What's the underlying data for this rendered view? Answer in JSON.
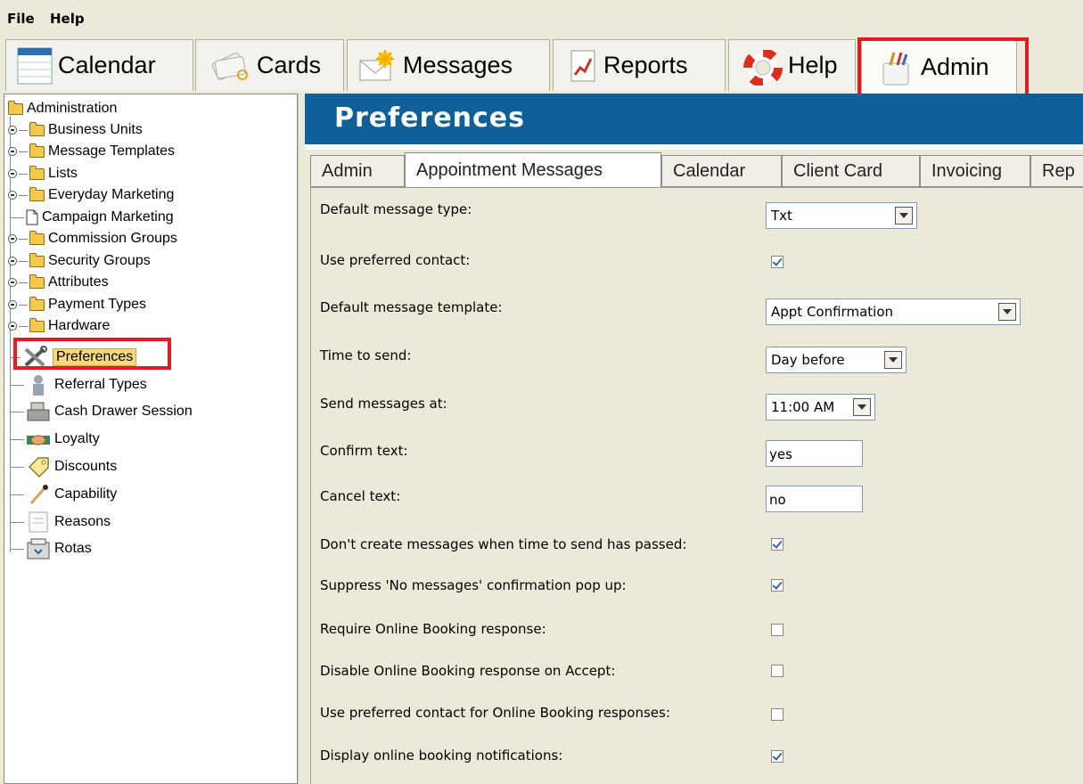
{
  "menu": {
    "file": "File",
    "help": "Help"
  },
  "toolbar": {
    "calendar": "Calendar",
    "cards": "Cards",
    "messages": "Messages",
    "reports": "Reports",
    "help": "Help",
    "admin": "Admin"
  },
  "tree": {
    "root": "Administration",
    "items": [
      "Business Units",
      "Message Templates",
      "Lists",
      "Everyday Marketing",
      "Campaign Marketing",
      "Commission Groups",
      "Security Groups",
      "Attributes",
      "Payment Types",
      "Hardware",
      "Preferences",
      "Referral Types",
      "Cash Drawer Session",
      "Loyalty",
      "Discounts",
      "Capability",
      "Reasons",
      "Rotas"
    ]
  },
  "banner": {
    "title": "Preferences"
  },
  "subtabs": [
    "Admin",
    "Appointment Messages",
    "Calendar",
    "Client Card",
    "Invoicing",
    "Rep"
  ],
  "form": {
    "default_message_type": {
      "label": "Default message type:",
      "value": "Txt"
    },
    "use_preferred_contact": {
      "label": "Use preferred contact:",
      "checked": true
    },
    "default_message_template": {
      "label": "Default message template:",
      "value": "Appt Confirmation"
    },
    "time_to_send": {
      "label": "Time to send:",
      "value": "Day before"
    },
    "send_messages_at": {
      "label": "Send messages at:",
      "value": "11:00 AM"
    },
    "confirm_text": {
      "label": "Confirm text:",
      "value": "yes"
    },
    "cancel_text": {
      "label": "Cancel text:",
      "value": "no"
    },
    "dont_create_passed": {
      "label": "Don't create messages when time to send has passed:",
      "checked": true
    },
    "suppress_no_messages": {
      "label": "Suppress 'No messages' confirmation pop up:",
      "checked": true
    },
    "require_online_booking": {
      "label": "Require Online Booking response:",
      "checked": false
    },
    "disable_online_booking_accept": {
      "label": "Disable Online Booking response on Accept:",
      "checked": false
    },
    "use_preferred_online": {
      "label": "Use preferred contact for Online Booking responses:",
      "checked": false
    },
    "display_online_notifications": {
      "label": "Display online booking notifications:",
      "checked": true
    }
  }
}
